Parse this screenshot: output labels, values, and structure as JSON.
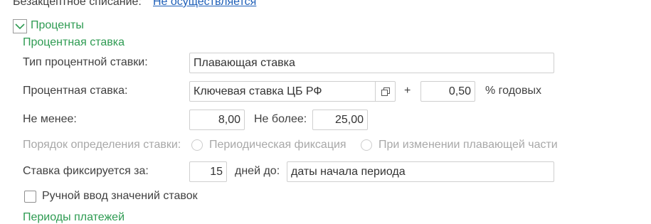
{
  "top_row": {
    "label": "Безакцептное списание:",
    "link": "Не осуществляется"
  },
  "group": {
    "title": "Проценты",
    "expanded": true,
    "icon": "chevron-down-icon"
  },
  "rate_section": {
    "title": "Процентная ставка",
    "rate_type": {
      "label": "Тип процентной ставки:",
      "value": "Плавающая ставка"
    },
    "rate": {
      "label": "Процентная ставка:",
      "value": "Ключевая ставка ЦБ РФ",
      "open_icon": "open-form-icon",
      "plus": "+",
      "addition": "0,50",
      "unit": "% годовых"
    },
    "min": {
      "label": "Не менее:",
      "value": "8,00"
    },
    "max": {
      "label": "Не более:",
      "value": "25,00"
    },
    "order": {
      "label": "Порядок определения ставки:",
      "option1": "Периодическая фиксация",
      "option2": "При изменении плавающей части",
      "enabled": false
    },
    "fixed_for": {
      "label": "Ставка фиксируется за:",
      "value": "15",
      "days_label": "дней до:",
      "until": "даты начала периода"
    },
    "manual_input": {
      "label": "Ручной ввод значений ставок",
      "checked": false
    }
  },
  "payment_periods": {
    "title": "Периоды платежей"
  }
}
